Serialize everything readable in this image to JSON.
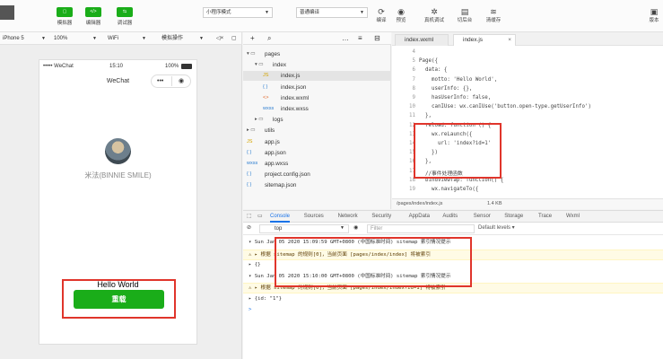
{
  "toolbar": {
    "mode_buttons": [
      {
        "label": "模拟器",
        "glyph": "▢"
      },
      {
        "label": "编辑器",
        "glyph": "</>"
      },
      {
        "label": "调试器",
        "glyph": "⇆"
      }
    ],
    "compile_mode": "小程序模式",
    "compile_target": "普通编译",
    "actions": [
      {
        "label": "编译",
        "icon": "refresh-icon"
      },
      {
        "label": "预览",
        "icon": "eye-icon"
      },
      {
        "label": "真机调试",
        "icon": "bug-icon"
      },
      {
        "label": "切后台",
        "icon": "switch-icon"
      },
      {
        "label": "清缓存",
        "icon": "layers-icon"
      }
    ],
    "right_label": "版本"
  },
  "simulator": {
    "device": "iPhone 5",
    "zoom": "100%",
    "network": "WiFi",
    "sim_action": "模拟操作",
    "status": {
      "carrier": "••••• WeChat",
      "time": "15:10",
      "battery": "100%"
    },
    "nav_title": "WeChat",
    "capsule": {
      "more": "•••",
      "close": "◉"
    },
    "nickname": "米法(BINNIE SMILE)",
    "hello": "Hello World",
    "reload_label": "重载"
  },
  "tree": {
    "items": [
      {
        "label": "pages",
        "kind": "folder-open",
        "depth": 0
      },
      {
        "label": "index",
        "kind": "folder-open",
        "depth": 1
      },
      {
        "label": "index.js",
        "kind": "js",
        "depth": 2,
        "selected": true
      },
      {
        "label": "index.json",
        "kind": "json",
        "depth": 2
      },
      {
        "label": "index.wxml",
        "kind": "wxml",
        "depth": 2
      },
      {
        "label": "index.wxss",
        "kind": "wxss",
        "depth": 2
      },
      {
        "label": "logs",
        "kind": "folder",
        "depth": 1
      },
      {
        "label": "utils",
        "kind": "folder",
        "depth": 0
      },
      {
        "label": "app.js",
        "kind": "js",
        "depth": 0
      },
      {
        "label": "app.json",
        "kind": "json",
        "depth": 0
      },
      {
        "label": "app.wxss",
        "kind": "wxss",
        "depth": 0
      },
      {
        "label": "project.config.json",
        "kind": "json",
        "depth": 0
      },
      {
        "label": "sitemap.json",
        "kind": "json",
        "depth": 0
      }
    ]
  },
  "editor": {
    "tabs": [
      {
        "label": "index.wxml",
        "active": false
      },
      {
        "label": "index.js",
        "active": true
      }
    ],
    "lines": [
      {
        "n": "4",
        "text": ""
      },
      {
        "n": "5",
        "text": "Page({"
      },
      {
        "n": "6",
        "text": "  data: {"
      },
      {
        "n": "7",
        "text": "    motto: 'Hello World',"
      },
      {
        "n": "8",
        "text": "    userInfo: {},"
      },
      {
        "n": "9",
        "text": "    hasUserInfo: false,"
      },
      {
        "n": "10",
        "text": "    canIUse: wx.canIUse('button.open-type.getUserInfo')"
      },
      {
        "n": "11",
        "text": "  },"
      },
      {
        "n": "12",
        "text": "  reload: function () {"
      },
      {
        "n": "13",
        "text": "    wx.reLaunch({"
      },
      {
        "n": "14",
        "text": "      url: 'index?id=1'"
      },
      {
        "n": "15",
        "text": "    })"
      },
      {
        "n": "16",
        "text": "  },"
      },
      {
        "n": "17",
        "text": "  //事件处理函数"
      },
      {
        "n": "18",
        "text": "  bindViewTap: function() {"
      },
      {
        "n": "19",
        "text": "    wx.navigateTo({"
      }
    ],
    "status_path": "/pages/index/index.js",
    "status_size": "1.4 KB"
  },
  "console": {
    "tabs": [
      "Console",
      "Sources",
      "Network",
      "Security",
      "AppData",
      "Audits",
      "Sensor",
      "Storage",
      "Trace",
      "Wxml"
    ],
    "context": "top",
    "filter_placeholder": "Filter",
    "levels": "Default levels ▾",
    "lines": [
      {
        "type": "log",
        "text": "▾ Sun Jan 05 2020 15:09:59 GMT+0800 (中国标准时间) sitemap 索引情况提示"
      },
      {
        "type": "warn",
        "text": "  ⚠ ▸ 根据 sitemap 的规则[0]，当前页面 [pages/index/index] 将被索引"
      },
      {
        "type": "log",
        "text": "  ▸ {}"
      },
      {
        "type": "log",
        "text": "▾ Sun Jan 05 2020 15:10:00 GMT+0800 (中国标准时间) sitemap 索引情况提示"
      },
      {
        "type": "warn",
        "text": "  ⚠ ▸ 根据 sitemap 的规则[0]，当前页面 [pages/index/index?id=1] 将被索引"
      },
      {
        "type": "log",
        "text": "  ▸ {id: \"1\"}"
      },
      {
        "type": "prompt",
        "text": ">"
      }
    ]
  },
  "colors": {
    "accent_green": "#1aad19",
    "highlight_red": "#e0352b",
    "link_blue": "#1a73e8"
  }
}
